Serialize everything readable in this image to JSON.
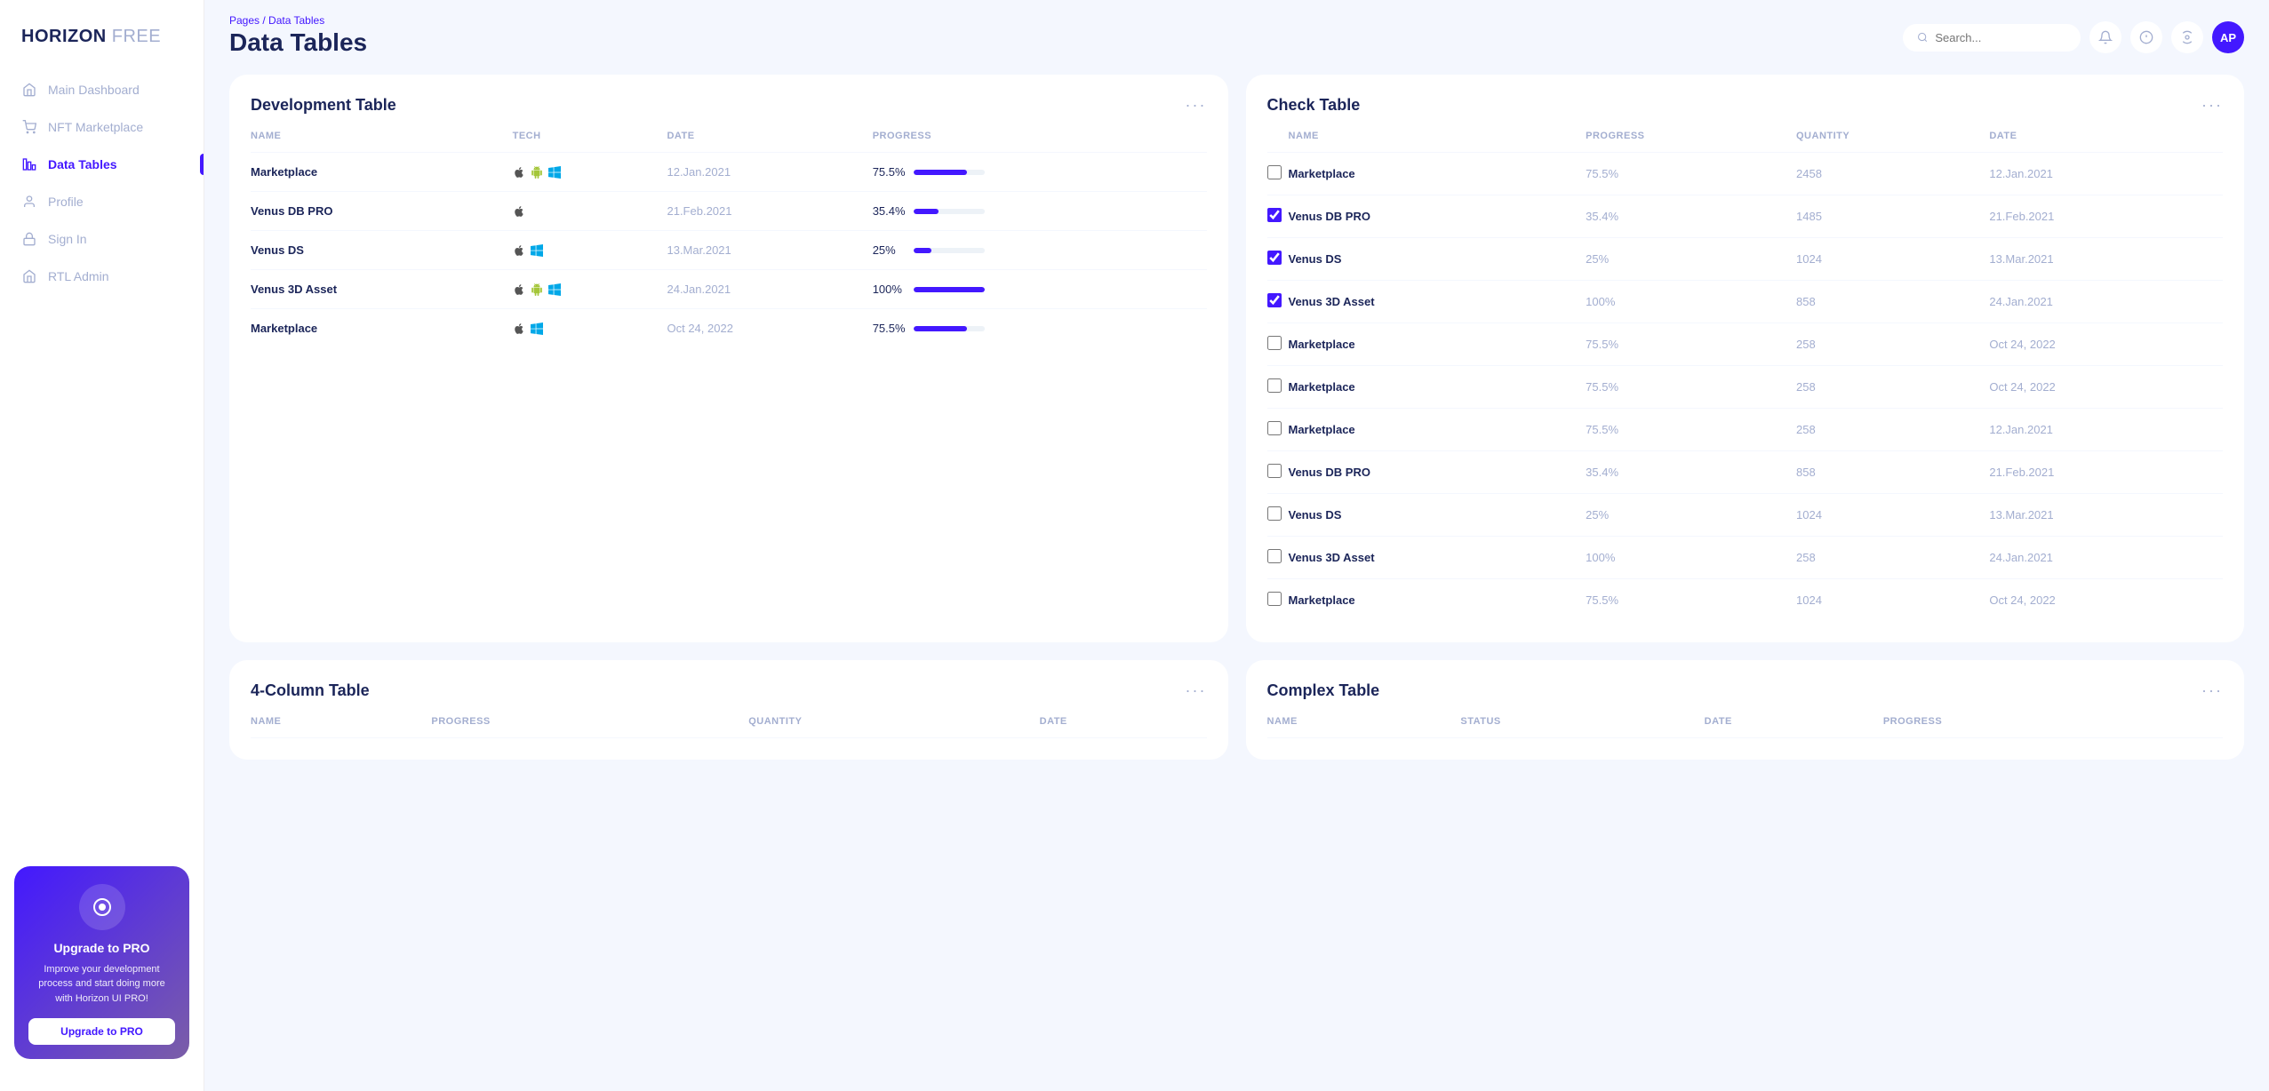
{
  "brand": {
    "name_bold": "HORIZON",
    "name_light": " FREE"
  },
  "sidebar": {
    "items": [
      {
        "id": "main-dashboard",
        "label": "Main Dashboard",
        "icon": "🏠",
        "active": false
      },
      {
        "id": "nft-marketplace",
        "label": "NFT Marketplace",
        "icon": "🛒",
        "active": false
      },
      {
        "id": "data-tables",
        "label": "Data Tables",
        "icon": "📊",
        "active": true
      },
      {
        "id": "profile",
        "label": "Profile",
        "icon": "👤",
        "active": false
      },
      {
        "id": "sign-in",
        "label": "Sign In",
        "icon": "🔒",
        "active": false
      },
      {
        "id": "rtl-admin",
        "label": "RTL Admin",
        "icon": "🏠",
        "active": false
      }
    ]
  },
  "upgrade": {
    "title": "Upgrade to PRO",
    "description": "Improve your development process and start doing more with Horizon UI PRO!",
    "button_label": "Upgrade to PRO",
    "icon": "◎"
  },
  "header": {
    "breadcrumb_root": "Pages",
    "breadcrumb_separator": "/",
    "breadcrumb_current": "Data Tables",
    "page_title": "Data Tables",
    "search_placeholder": "Search...",
    "avatar_initials": "AP"
  },
  "dev_table": {
    "title": "Development Table",
    "columns": [
      "NAME",
      "TECH",
      "DATE",
      "PROGRESS"
    ],
    "rows": [
      {
        "name": "Marketplace",
        "tech": [
          "🍎",
          "🤖",
          "🪟"
        ],
        "date": "12.Jan.2021",
        "progress_pct": 75.5,
        "progress_label": "75.5%"
      },
      {
        "name": "Venus DB PRO",
        "tech": [
          "🍎"
        ],
        "date": "21.Feb.2021",
        "progress_pct": 35.4,
        "progress_label": "35.4%"
      },
      {
        "name": "Venus DS",
        "tech": [
          "🍎",
          "🪟"
        ],
        "date": "13.Mar.2021",
        "progress_pct": 25,
        "progress_label": "25%"
      },
      {
        "name": "Venus 3D Asset",
        "tech": [
          "🍎",
          "🤖",
          "🪟"
        ],
        "date": "24.Jan.2021",
        "progress_pct": 100,
        "progress_label": "100%"
      },
      {
        "name": "Marketplace",
        "tech": [
          "🍎",
          "🪟"
        ],
        "date": "Oct 24, 2022",
        "progress_pct": 75.5,
        "progress_label": "75.5%"
      }
    ]
  },
  "check_table": {
    "title": "Check Table",
    "columns": [
      "NAME",
      "PROGRESS",
      "QUANTITY",
      "DATE"
    ],
    "rows": [
      {
        "name": "Marketplace",
        "checked": false,
        "progress": "75.5%",
        "quantity": "2458",
        "date": "12.Jan.2021"
      },
      {
        "name": "Venus DB PRO",
        "checked": true,
        "progress": "35.4%",
        "quantity": "1485",
        "date": "21.Feb.2021"
      },
      {
        "name": "Venus DS",
        "checked": true,
        "progress": "25%",
        "quantity": "1024",
        "date": "13.Mar.2021"
      },
      {
        "name": "Venus 3D Asset",
        "checked": true,
        "progress": "100%",
        "quantity": "858",
        "date": "24.Jan.2021"
      },
      {
        "name": "Marketplace",
        "checked": false,
        "progress": "75.5%",
        "quantity": "258",
        "date": "Oct 24, 2022"
      },
      {
        "name": "Marketplace",
        "checked": false,
        "progress": "75.5%",
        "quantity": "258",
        "date": "Oct 24, 2022"
      },
      {
        "name": "Marketplace",
        "checked": false,
        "progress": "75.5%",
        "quantity": "258",
        "date": "12.Jan.2021"
      },
      {
        "name": "Venus DB PRO",
        "checked": false,
        "progress": "35.4%",
        "quantity": "858",
        "date": "21.Feb.2021"
      },
      {
        "name": "Venus DS",
        "checked": false,
        "progress": "25%",
        "quantity": "1024",
        "date": "13.Mar.2021"
      },
      {
        "name": "Venus 3D Asset",
        "checked": false,
        "progress": "100%",
        "quantity": "258",
        "date": "24.Jan.2021"
      },
      {
        "name": "Marketplace",
        "checked": false,
        "progress": "75.5%",
        "quantity": "1024",
        "date": "Oct 24, 2022"
      }
    ]
  },
  "four_col_table": {
    "title": "4-Column Table",
    "columns": [
      "NAME",
      "PROGRESS",
      "QUANTITY",
      "DATE"
    ]
  },
  "complex_table": {
    "title": "Complex Table",
    "columns": [
      "NAME",
      "STATUS",
      "DATE",
      "PROGRESS"
    ]
  }
}
